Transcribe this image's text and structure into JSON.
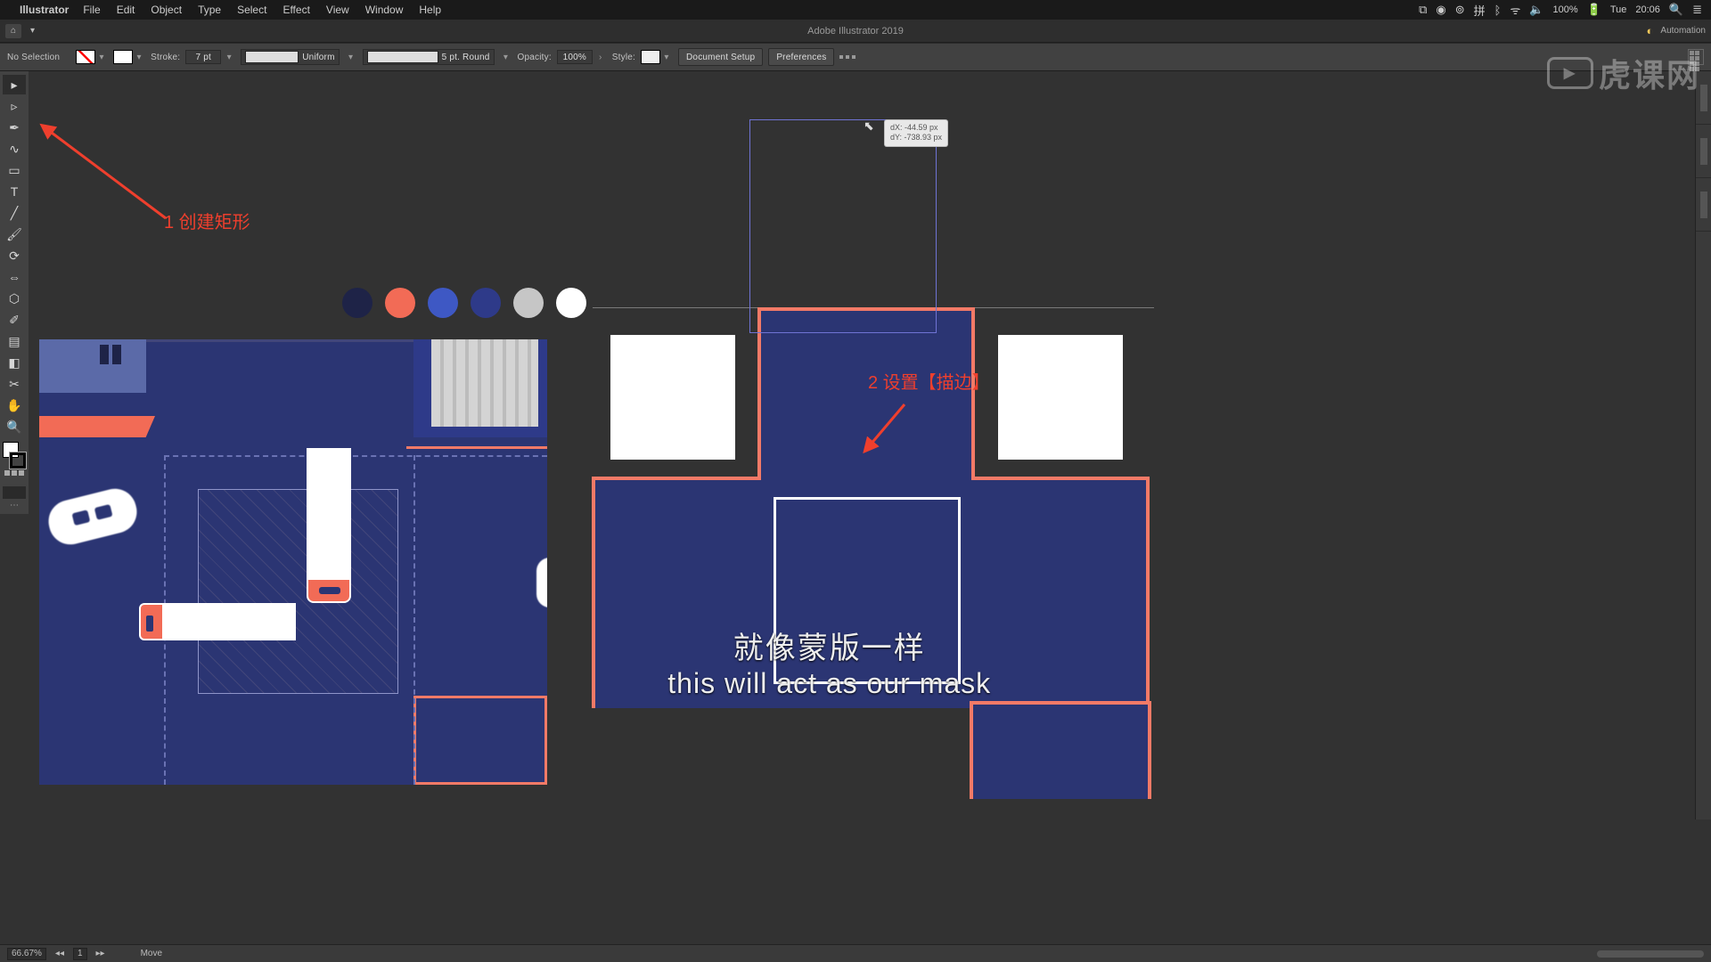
{
  "menubar": {
    "apple": "",
    "app": "Illustrator",
    "items": [
      "File",
      "Edit",
      "Object",
      "Type",
      "Select",
      "Effect",
      "View",
      "Window",
      "Help"
    ],
    "status": {
      "battery": "100%",
      "day": "Tue",
      "time": "20:06",
      "input": "拼",
      "glyphs": [
        "⧉",
        "◉",
        "⊚",
        "⍉",
        "ᛒ",
        "ᯤ",
        "🔈",
        "🔋",
        "🔍",
        "≣"
      ]
    }
  },
  "docbar": {
    "title": "Adobe Illustrator 2019",
    "tab": "▾",
    "right_label": "Automation"
  },
  "controlbar": {
    "selection": "No Selection",
    "stroke_label": "Stroke:",
    "stroke_pt": "7 pt",
    "stroke_profile": "Uniform",
    "brush": "5 pt. Round",
    "opacity_label": "Opacity:",
    "opacity": "100%",
    "style_label": "Style:",
    "doc_setup": "Document Setup",
    "prefs": "Preferences"
  },
  "tools": [
    "Selection",
    "Direct Selection",
    "Pen",
    "Curvature",
    "Type",
    "Line",
    "Rectangle",
    "Paintbrush",
    "Pencil",
    "Eraser",
    "Rotate",
    "Scale",
    "Width",
    "Free Transform",
    "Shape Builder",
    "Gradient",
    "Eyedropper",
    "Blend",
    "Symbol Sprayer",
    "Column Graph",
    "Artboard",
    "Slice",
    "Hand",
    "Zoom"
  ],
  "annotations": {
    "a1": "1 创建矩形",
    "a2": "2 设置【描边】"
  },
  "palette_colors": [
    "#1e2347",
    "#f26b56",
    "#3e58c4",
    "#2e3a89",
    "#c6c6c6",
    "#ffffff"
  ],
  "smart_guide": {
    "dx": "dX: -44.59 px",
    "dy": "dY: -738.93 px"
  },
  "subtitles": {
    "zh": "就像蒙版一样",
    "en": "this will act as our mask"
  },
  "watermark": {
    "text": "虎课网",
    "logo": "▶"
  },
  "statusbar": {
    "zoom": "66.67%",
    "artboard": "1",
    "tool": "Move"
  },
  "chart_data": null
}
